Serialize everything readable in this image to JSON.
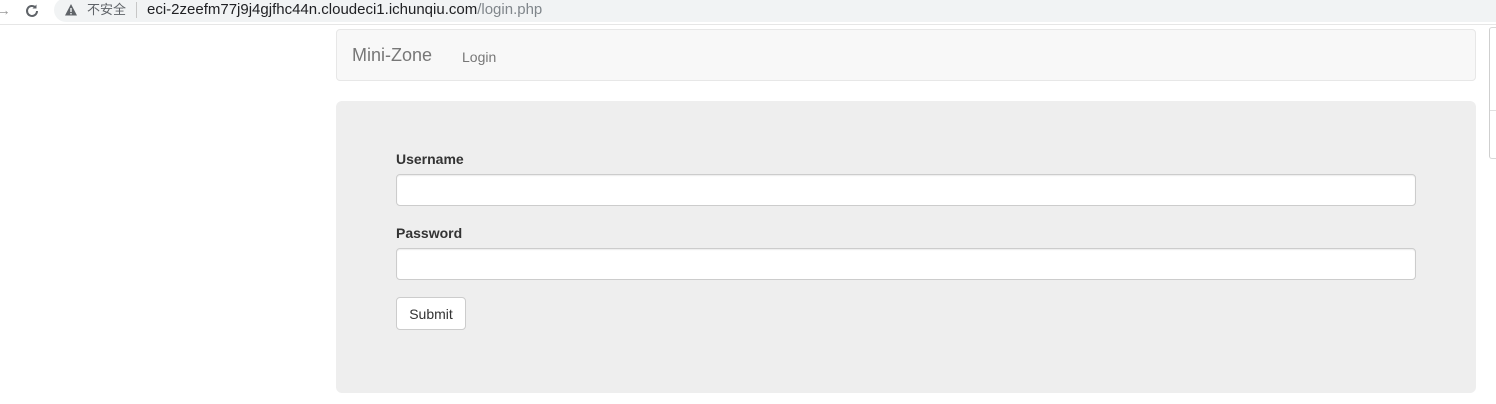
{
  "browser": {
    "security_label": "不安全",
    "url_host": "eci-2zeefm77j9j4gjfhc44n.cloudeci1.ichunqiu.com",
    "url_path": "/login.php"
  },
  "navbar": {
    "brand": "Mini-Zone",
    "links": [
      "Login"
    ]
  },
  "form": {
    "username_label": "Username",
    "username_value": "",
    "password_label": "Password",
    "password_value": "",
    "submit_label": "Submit"
  }
}
